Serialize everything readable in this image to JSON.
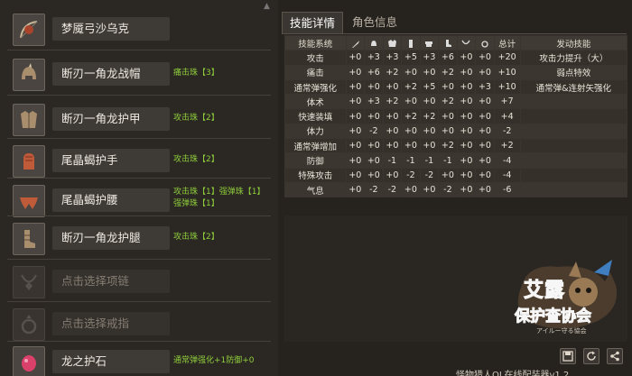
{
  "equipment": [
    {
      "name": "梦魇弓沙乌克",
      "icon": "bow-icon",
      "deco": []
    },
    {
      "name": "断刃一角龙战帽",
      "icon": "helm-icon",
      "deco": [
        "痛击珠【3】"
      ]
    },
    {
      "name": "断刃一角龙护甲",
      "icon": "chest-armor-icon",
      "deco": [
        "攻击珠【2】"
      ]
    },
    {
      "name": "尾晶蝎护手",
      "icon": "gauntlet-icon",
      "deco": [
        "攻击珠【2】"
      ]
    },
    {
      "name": "尾晶蝎护腰",
      "icon": "waist-armor-icon",
      "deco": [
        "攻击珠【1】强弹珠【1】",
        "强弹珠【1】"
      ]
    },
    {
      "name": "断刃一角龙护腿",
      "icon": "leg-armor-icon",
      "deco": [
        "攻击珠【2】"
      ]
    },
    {
      "name": "点击选择项链",
      "icon": "necklace-icon",
      "deco": []
    },
    {
      "name": "点击选择戒指",
      "icon": "ring-icon",
      "deco": []
    },
    {
      "name": "龙之护石",
      "icon": "charm-icon",
      "deco": [
        "通常弹强化+1防御+0"
      ]
    }
  ],
  "tabs": [
    "技能详情",
    "角色信息"
  ],
  "table": {
    "header_skill": "技能系统",
    "header_total": "总计",
    "header_effect": "发动技能",
    "col_icons": [
      "weapon-icon",
      "helm-icon",
      "chest-icon",
      "arm-icon",
      "waist-icon",
      "leg-icon",
      "necklace-icon",
      "ring-icon"
    ],
    "rows": [
      {
        "skill": "攻击",
        "vals": [
          "+0",
          "+3",
          "+3",
          "+5",
          "+3",
          "+6",
          "+0",
          "+0"
        ],
        "total": "+20",
        "effect": "攻击力提升（大）"
      },
      {
        "skill": "痛击",
        "vals": [
          "+0",
          "+6",
          "+2",
          "+0",
          "+0",
          "+2",
          "+0",
          "+0"
        ],
        "total": "+10",
        "effect": "弱点特效"
      },
      {
        "skill": "通常弹强化",
        "vals": [
          "+0",
          "+0",
          "+0",
          "+2",
          "+5",
          "+0",
          "+0",
          "+3"
        ],
        "total": "+10",
        "effect": "通常弹&连射矢强化"
      },
      {
        "skill": "体术",
        "vals": [
          "+0",
          "+3",
          "+2",
          "+0",
          "+0",
          "+2",
          "+0",
          "+0"
        ],
        "total": "+7",
        "effect": ""
      },
      {
        "skill": "快速装填",
        "vals": [
          "+0",
          "+0",
          "+0",
          "+2",
          "+2",
          "+0",
          "+0",
          "+0"
        ],
        "total": "+4",
        "effect": ""
      },
      {
        "skill": "体力",
        "vals": [
          "+0",
          "-2",
          "+0",
          "+0",
          "+0",
          "+0",
          "+0",
          "+0"
        ],
        "total": "-2",
        "effect": ""
      },
      {
        "skill": "通常弹增加",
        "vals": [
          "+0",
          "+0",
          "+0",
          "+0",
          "+0",
          "+2",
          "+0",
          "+0"
        ],
        "total": "+2",
        "effect": ""
      },
      {
        "skill": "防御",
        "vals": [
          "+0",
          "+0",
          "-1",
          "-1",
          "-1",
          "-1",
          "+0",
          "+0"
        ],
        "total": "-4",
        "effect": ""
      },
      {
        "skill": "特殊攻击",
        "vals": [
          "+0",
          "+0",
          "+0",
          "-2",
          "-2",
          "+0",
          "+0",
          "+0"
        ],
        "total": "-4",
        "effect": ""
      },
      {
        "skill": "气息",
        "vals": [
          "+0",
          "-2",
          "-2",
          "+0",
          "+0",
          "-2",
          "+0",
          "+0"
        ],
        "total": "-6",
        "effect": ""
      }
    ]
  },
  "logo": {
    "line1": "艾露",
    "line2": "保护查协会",
    "line3": "アイルー守る協会"
  },
  "footer": "怪物猎人OL在线配装器v1.2",
  "buttons": [
    "save-icon",
    "refresh-icon",
    "share-icon"
  ]
}
